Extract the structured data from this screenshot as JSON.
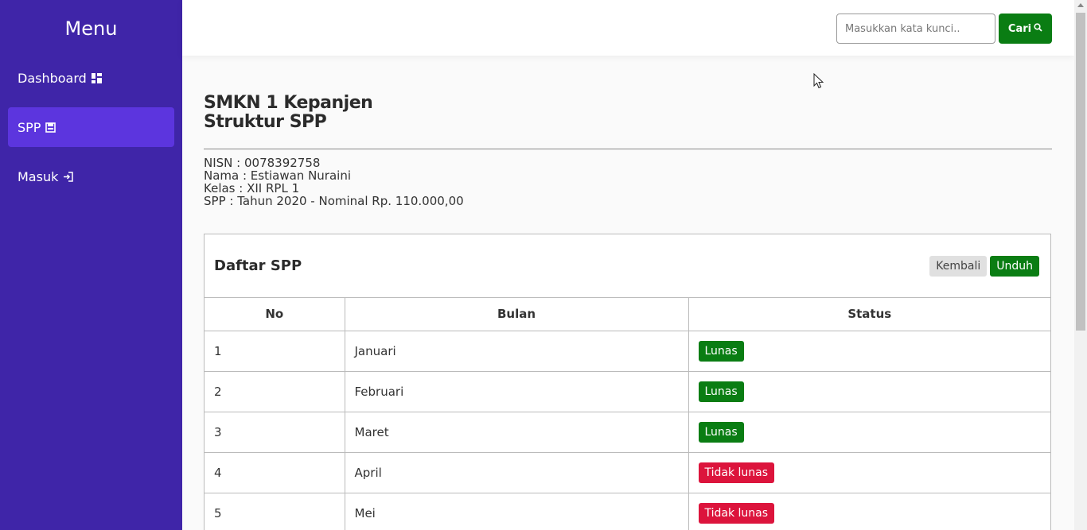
{
  "sidebar": {
    "title": "Menu",
    "items": [
      {
        "label": "Dashboard",
        "icon": "dashboard-icon"
      },
      {
        "label": "SPP",
        "icon": "register-icon"
      },
      {
        "label": "Masuk",
        "icon": "login-icon"
      }
    ]
  },
  "search": {
    "placeholder": "Masukkan kata kunci..",
    "button_label": "Cari"
  },
  "header": {
    "school": "SMKN 1 Kepanjen",
    "title": "Struktur SPP"
  },
  "student": {
    "nisn": "NISN : 0078392758",
    "nama": "Nama : Estiawan Nuraini",
    "kelas": "Kelas : XII RPL 1",
    "spp": "SPP : Tahun 2020 - Nominal Rp. 110.000,00"
  },
  "card": {
    "title": "Daftar SPP",
    "back_label": "Kembali",
    "download_label": "Unduh"
  },
  "table": {
    "headers": [
      "No",
      "Bulan",
      "Status"
    ],
    "rows": [
      {
        "no": "1",
        "bulan": "Januari",
        "status": "Lunas"
      },
      {
        "no": "2",
        "bulan": "Februari",
        "status": "Lunas"
      },
      {
        "no": "3",
        "bulan": "Maret",
        "status": "Lunas"
      },
      {
        "no": "4",
        "bulan": "April",
        "status": "Tidak lunas"
      },
      {
        "no": "5",
        "bulan": "Mei",
        "status": "Tidak lunas"
      }
    ]
  },
  "colors": {
    "sidebar": "#3f25a8",
    "sidebar_active": "#5c35de",
    "success": "#0a7d13",
    "danger": "#dc143c"
  }
}
